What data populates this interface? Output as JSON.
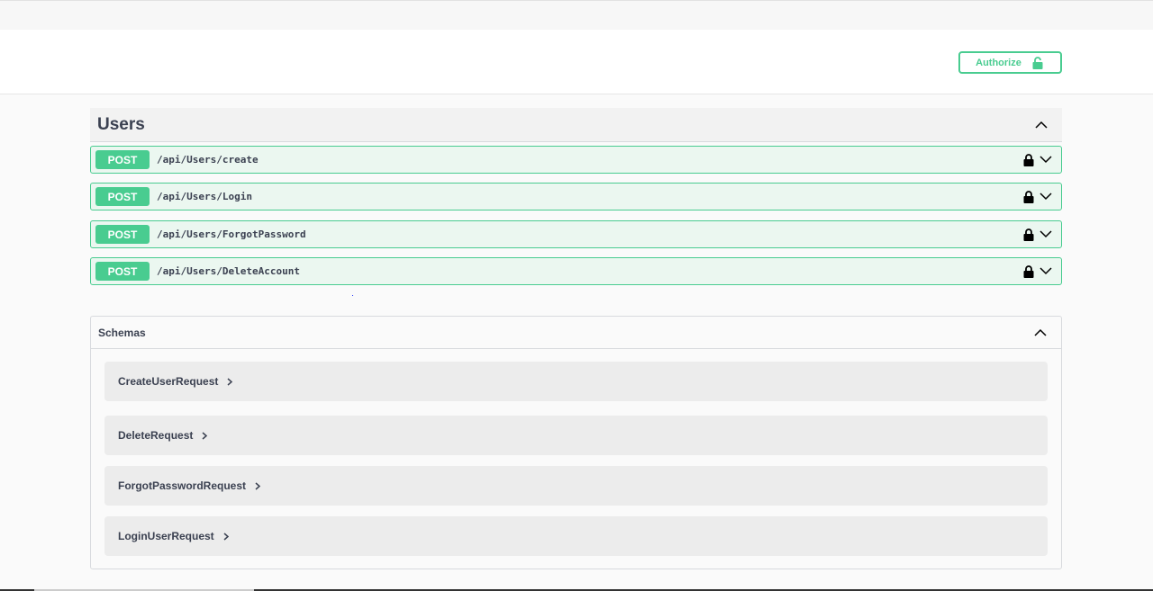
{
  "auth": {
    "authorize_label": "Authorize"
  },
  "tag": {
    "title": "Users"
  },
  "operations": [
    {
      "method": "POST",
      "path": "/api/Users/create"
    },
    {
      "method": "POST",
      "path": "/api/Users/Login"
    },
    {
      "method": "POST",
      "path": "/api/Users/ForgotPassword"
    },
    {
      "method": "POST",
      "path": "/api/Users/DeleteAccount"
    }
  ],
  "schemas": {
    "title": "Schemas",
    "models": [
      {
        "name": "CreateUserRequest"
      },
      {
        "name": "DeleteRequest"
      },
      {
        "name": "ForgotPasswordRequest"
      },
      {
        "name": "LoginUserRequest"
      }
    ]
  },
  "colors": {
    "post": "#49cc90",
    "post_bg": "#ebf7f0",
    "text": "#3b4151"
  }
}
